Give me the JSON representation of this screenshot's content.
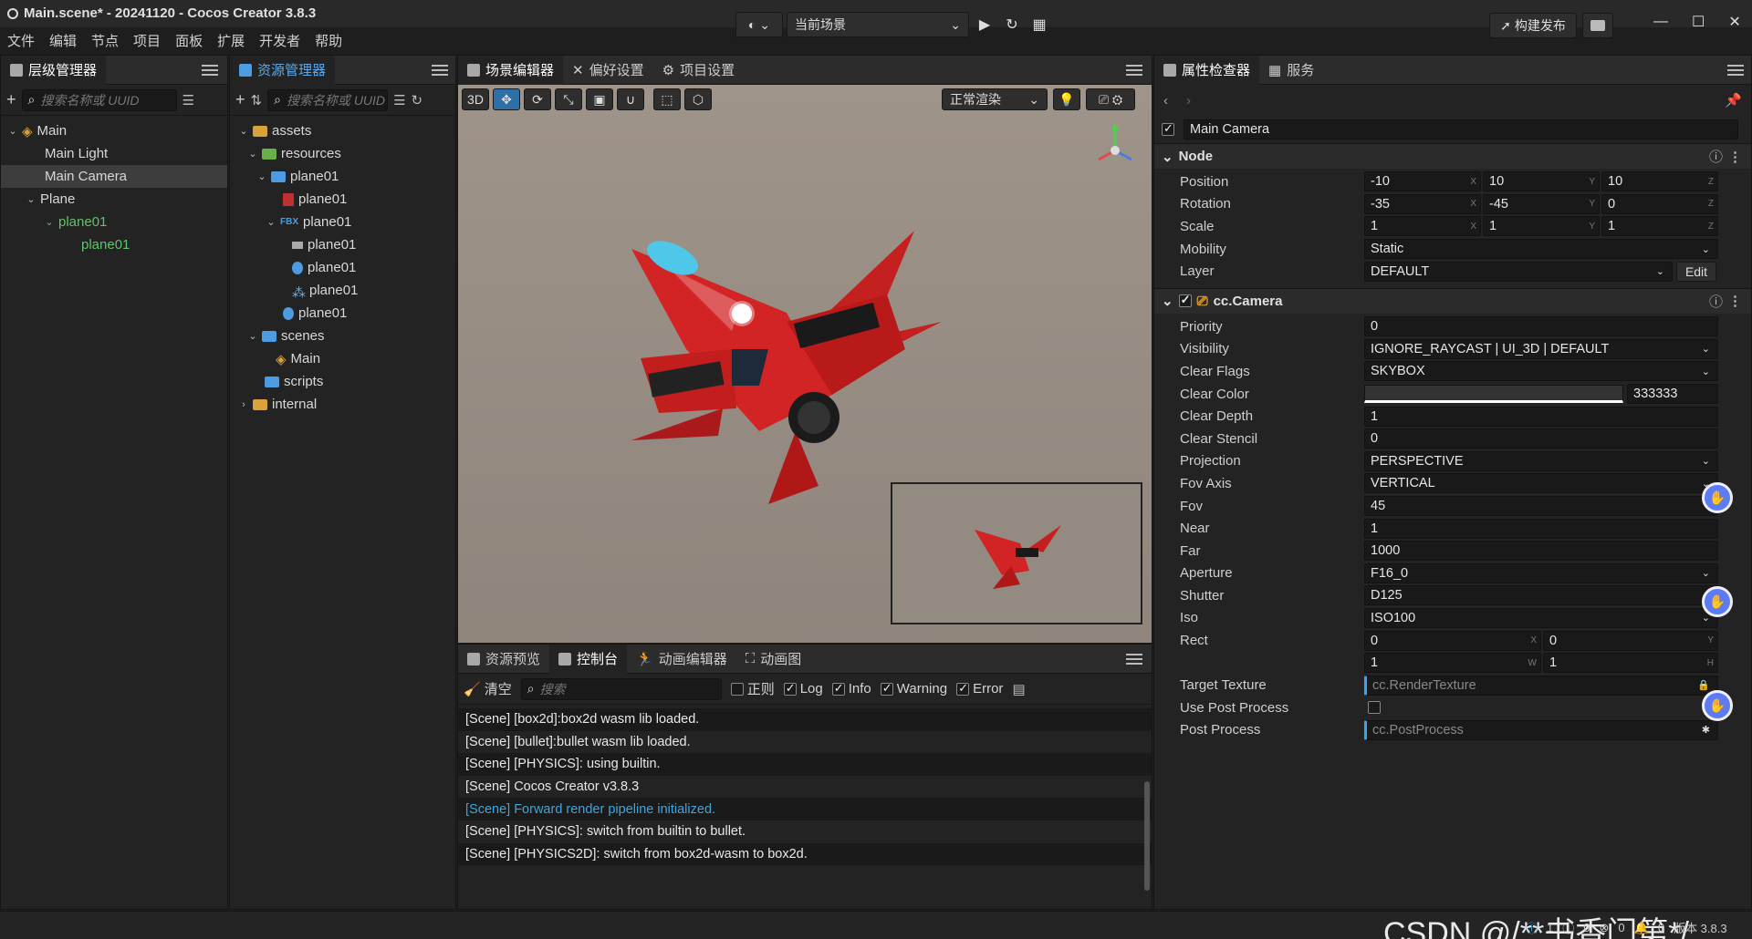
{
  "window": {
    "title": "Main.scene* - 20241120 - Cocos Creator 3.8.3"
  },
  "menu": [
    "文件",
    "编辑",
    "节点",
    "项目",
    "面板",
    "扩展",
    "开发者",
    "帮助"
  ],
  "topbar": {
    "scene_select": "当前场景",
    "build_btn": "构建发布"
  },
  "hierarchy": {
    "tab": "层级管理器",
    "search_placeholder": "搜索名称或 UUID",
    "items": [
      {
        "label": "Main"
      },
      {
        "label": "Main Light"
      },
      {
        "label": "Main Camera"
      },
      {
        "label": "Plane"
      },
      {
        "label": "plane01"
      },
      {
        "label": "plane01"
      }
    ]
  },
  "assets": {
    "tab": "资源管理器",
    "search_placeholder": "搜索名称或 UUID",
    "items": [
      {
        "label": "assets"
      },
      {
        "label": "resources"
      },
      {
        "label": "plane01"
      },
      {
        "label": "plane01"
      },
      {
        "label": "plane01"
      },
      {
        "label": "plane01"
      },
      {
        "label": "plane01"
      },
      {
        "label": "plane01"
      },
      {
        "label": "plane01"
      },
      {
        "label": "scenes"
      },
      {
        "label": "Main"
      },
      {
        "label": "scripts"
      },
      {
        "label": "internal"
      }
    ]
  },
  "scene": {
    "tabs": [
      "场景编辑器",
      "偏好设置",
      "项目设置"
    ],
    "mode_3d": "3D",
    "render_mode": "正常渲染"
  },
  "console": {
    "tabs": [
      "资源预览",
      "控制台",
      "动画编辑器",
      "动画图"
    ],
    "clear": "清空",
    "search_placeholder": "搜索",
    "filters": [
      "正则",
      "Log",
      "Info",
      "Warning",
      "Error"
    ],
    "lines": [
      "[Scene] [box2d]:box2d wasm lib loaded.",
      "[Scene] [bullet]:bullet wasm lib loaded.",
      "[Scene] [PHYSICS]: using builtin.",
      "[Scene] Cocos Creator v3.8.3",
      "[Scene] Forward render pipeline initialized.",
      "[Scene] [PHYSICS]: switch from builtin to bullet.",
      "[Scene] [PHYSICS2D]: switch from box2d-wasm to box2d."
    ]
  },
  "inspector": {
    "tabs": [
      "属性检查器",
      "服务"
    ],
    "node_name": "Main Camera",
    "node_section": "Node",
    "position": [
      "-10",
      "10",
      "10"
    ],
    "rotation": [
      "-35",
      "-45",
      "0"
    ],
    "scale": [
      "1",
      "1",
      "1"
    ],
    "mobility": "Static",
    "layer": "DEFAULT",
    "edit": "Edit",
    "camera_section": "cc.Camera",
    "labels": {
      "position": "Position",
      "rotation": "Rotation",
      "scale": "Scale",
      "mobility": "Mobility",
      "layer": "Layer",
      "priority": "Priority",
      "visibility": "Visibility",
      "clear_flags": "Clear Flags",
      "clear_color": "Clear Color",
      "clear_depth": "Clear Depth",
      "clear_stencil": "Clear Stencil",
      "projection": "Projection",
      "fov_axis": "Fov Axis",
      "fov": "Fov",
      "near": "Near",
      "far": "Far",
      "aperture": "Aperture",
      "shutter": "Shutter",
      "iso": "Iso",
      "rect": "Rect",
      "target_texture": "Target Texture",
      "use_post": "Use Post Process",
      "post_process": "Post Process"
    },
    "values": {
      "priority": "0",
      "visibility": "IGNORE_RAYCAST | UI_3D | DEFAULT",
      "clear_flags": "SKYBOX",
      "clear_color": "333333",
      "clear_depth": "1",
      "clear_stencil": "0",
      "projection": "PERSPECTIVE",
      "fov_axis": "VERTICAL",
      "fov": "45",
      "near": "1",
      "far": "1000",
      "aperture": "F16_0",
      "shutter": "D125",
      "iso": "ISO100",
      "rect": [
        "0",
        "0",
        "1",
        "1"
      ],
      "target_texture": "cc.RenderTexture",
      "post_process": "cc.PostProcess"
    }
  },
  "statusbar": {
    "watermark": "CSDN @/**书香门第*/",
    "counts": [
      "1",
      "0",
      "0",
      "0"
    ],
    "version": "版本 3.8.3"
  },
  "colors": {
    "accent": "#2f6fa8",
    "info": "#3aa6e0",
    "viewport": "#978b80"
  }
}
